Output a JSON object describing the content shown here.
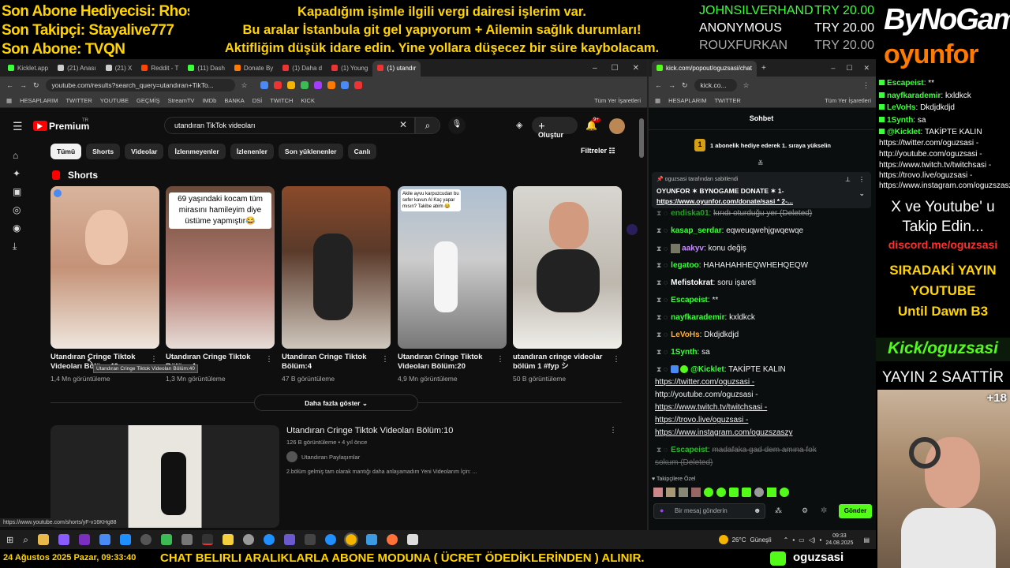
{
  "overlay": {
    "left_lines": [
      {
        "label": "Son Abone Hediyecisi:",
        "value": "Rhosyna"
      },
      {
        "label": "Son Takipçi:",
        "value": "Stayalive777"
      },
      {
        "label": "Son Abone:",
        "value": "TVQN"
      }
    ],
    "center_lines": [
      "Kapadığım işimle ilgili vergi dairesi işlerim var.",
      "Bu aralar İstanbula git gel yapıyorum + Ailemin sağlık durumları!",
      "Aktifliğim düşük idare edin. Yine yollara düşecez bir süre kaybolacam."
    ],
    "donors": [
      {
        "name": "JOHNSILVERHAND",
        "amount": "TRY 20.00"
      },
      {
        "name": "ANONYMOUS",
        "amount": "TRY 20.00"
      },
      {
        "name": "ROUXFURKAN",
        "amount": "TRY 20.00"
      }
    ],
    "brand_top": "ByNoGame",
    "brand_bottom": "oyunfor",
    "side_chat": [
      {
        "user": "Escapeist",
        "text": "**"
      },
      {
        "user": "nayfkarademir",
        "text": "kxldkck"
      },
      {
        "user": "LeVoHs",
        "text": "Dkdjdkdjd"
      },
      {
        "user": "1Synth",
        "text": "sa"
      },
      {
        "user": "@Kicklet",
        "text": "TAKİPTE KALIN"
      }
    ],
    "side_links": [
      "https://twitter.com/oguzsasi -",
      "http://youtube.com/oguzsasi -",
      "https://www.twitch.tv/twitchsasi -",
      "https://trovo.live/oguzsasi -",
      "https://www.instagram.com/oguzszaszy"
    ],
    "follow_line1": "X ve Youtube' u",
    "follow_line2": "Takip Edin...",
    "discord": "discord.me/oguzsasi",
    "next_stream_1": "SIRADAKİ YAYIN",
    "next_stream_2": "YOUTUBE",
    "next_stream_3": "Until Dawn B3",
    "kick_handle": "Kick/oguzsasi",
    "stream_time": "YAYIN 2 SAATTİR",
    "age_badge": "+18",
    "bottom_date": "24 Ağustos 2025 Pazar, 09:33:40",
    "bottom_notice": "CHAT BELIRLI ARALIKLARLA ABONE MODUNA ( ÜCRET ÖDEDİKLERİNDEN ) ALINIR.",
    "bottom_handle": "oguzsasi"
  },
  "browser_left": {
    "tabs": [
      "Kicklet.app",
      "(21) Anası",
      "(21) X",
      "Reddit - T",
      "(11) Dash",
      "Donate By",
      "(1) Daha d",
      "(1) Young",
      "(1) utandır"
    ],
    "url": "youtube.com/results?search_query=utandıran+TikTo...",
    "bookmarks": [
      "HESAPLARIM",
      "TWITTER",
      "YOUTUBE",
      "GEÇMİŞ",
      "StreamTV",
      "IMDb",
      "BANKA",
      "DSİ",
      "TWITCH",
      "KICK",
      "Tüm Yer İşaretleri"
    ]
  },
  "youtube": {
    "logo": "Premium",
    "logo_sup": "TR",
    "search_value": "utandıran TikTok videoları",
    "create_label": "Oluştur",
    "notif_count": "9+",
    "chips": [
      "Tümü",
      "Shorts",
      "Videolar",
      "İzlenmeyenler",
      "İzlenenler",
      "Son yüklenenler",
      "Canlı"
    ],
    "filters_label": "Filtreler",
    "shorts_heading": "Shorts",
    "shorts": [
      {
        "title": "Utandıran Cringe Tiktok Videoları Bölüm:40",
        "views": "1,4 Mn görüntüleme",
        "overlay": ""
      },
      {
        "title": "Utandıran Cringe Tiktok Bölüm:4",
        "views": "1,3 Mn görüntüleme",
        "overlay": "69 yaşındaki kocam tüm mirasını hamileyim diye üstüme yapmıştır😂"
      },
      {
        "title": "Utandıran Cringe Tiktok Bölüm:4",
        "views": "47 B görüntüleme",
        "overlay": ""
      },
      {
        "title": "Utandıran Cringe Tiktok Videoları Bölüm:20",
        "views": "4,9 Mn görüntüleme",
        "overlay": "Akile ayvu karpuzcudan bu sefer kavun Al Kaç yapar mısın? Takibe abim 😂"
      },
      {
        "title": "utandıran cringe videolar bölüm 1 #fyp シ",
        "views": "50 B görüntüleme",
        "overlay": ""
      }
    ],
    "tooltip": "Utandıran Cringe Tiktok Videoları Bölüm:40",
    "more_label": "Daha fazla göster",
    "video": {
      "title": "Utandıran Cringe Tiktok Videoları Bölüm:10",
      "meta": "126 B görüntüleme • 4 yıl önce",
      "channel": "Utandıran Paylaşımlar",
      "desc": "2.bölüm gelmiş tam olarak mantığı daha anlayamadım Yeni Videolarım İçin: ..."
    },
    "status_url": "https://www.youtube.com/shorts/yF-v16KHg88"
  },
  "browser_right": {
    "tab": "kick.com/popout/oguzsasi/chat",
    "url": "kick.co...",
    "bookmarks": [
      "HESAPLARIM",
      "TWITTER",
      "Tüm Yer İşaretleri"
    ],
    "chat_title": "Sohbet",
    "gift_banner": "1 abonelik hediye ederek 1. sıraya yükselin",
    "gift_num": "1",
    "pinned_by": "oguzsasi tarafından sabitlendi",
    "pinned_text1": "OYUNFOR ✶ BYNOGAME DONATE ✶ 1-",
    "pinned_text2": "https://www.oyunfor.com/donate/sasi * 2-...",
    "messages": [
      {
        "user": "endiska01",
        "text": "kırıdı oturduğu yer (Deleted)",
        "color": "#3cff3c",
        "deleted": true
      },
      {
        "user": "kasap_serdar",
        "text": "eqweuqwehjgwqewqe",
        "color": "#3cff3c",
        "deleted": false
      },
      {
        "user": "aakyv",
        "text": "konu değiş",
        "color": "#c88cff",
        "deleted": false
      },
      {
        "user": "legatoo",
        "text": "HAHAHAHHEQWHEHQEQW",
        "color": "#3cff3c",
        "deleted": false
      },
      {
        "user": "Mefistokrat",
        "text": "soru işareti",
        "color": "#ffffff",
        "deleted": false
      },
      {
        "user": "Escapeist",
        "text": "**",
        "color": "#3cff3c",
        "deleted": false
      },
      {
        "user": "nayfkarademir",
        "text": "kxldkck",
        "color": "#3cff3c",
        "deleted": false
      },
      {
        "user": "LeVoHs",
        "text": "Dkdjdkdjd",
        "color": "#ffb13c",
        "deleted": false
      },
      {
        "user": "1Synth",
        "text": "sa",
        "color": "#3cff3c",
        "deleted": false
      },
      {
        "user": "@Kicklet",
        "text": "TAKİPTE KALIN",
        "color": "#3cff3c",
        "deleted": false
      }
    ],
    "links": [
      "https://twitter.com/oguzsasi -",
      "http://youtube.com/oguzsasi -",
      "https://www.twitch.tv/twitchsasi -",
      "https://trovo.live/oguzsasi -",
      "https://www.instagram.com/oguzszaszy"
    ],
    "last_user": "Escapeist",
    "last_text": "madafaka gad dem amına fok",
    "last_text2": "sokum (Deleted)",
    "emote_label": "Takipçilere Özel",
    "input_placeholder": "Bir mesaj gönderin",
    "send_label": "Gönder"
  },
  "taskbar": {
    "weather": "26°C",
    "weather_desc": "Güneşli",
    "time": "09:33",
    "date": "24.08.2025"
  },
  "colors": {
    "accent_yellow": "#ffd400",
    "kick_green": "#53fc18",
    "yt_red": "#ff0000",
    "orange": "#ff7a00"
  }
}
